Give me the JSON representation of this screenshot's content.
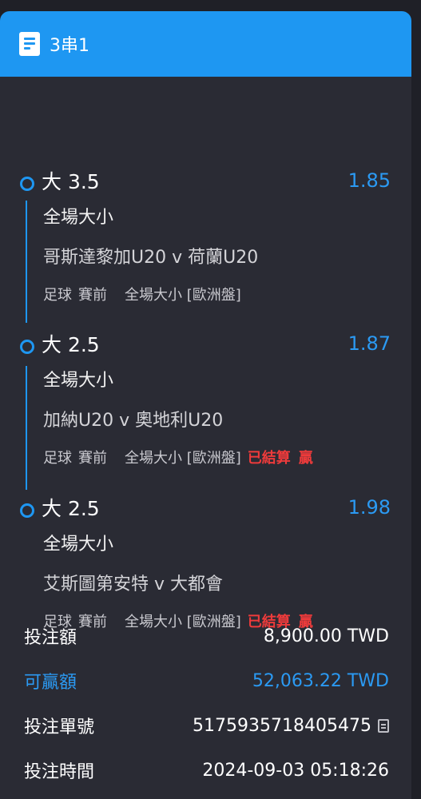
{
  "header": {
    "title": "3串1",
    "icon": "document-icon"
  },
  "legs": [
    {
      "pick": "大 3.5",
      "odds": "1.85",
      "market": "全場大小",
      "match": "哥斯達黎加U20 v 荷蘭U20",
      "sport": "足球",
      "stage": "賽前",
      "market_detail": "全場大小 [歐洲盤]",
      "status": "",
      "result": ""
    },
    {
      "pick": "大 2.5",
      "odds": "1.87",
      "market": "全場大小",
      "match": "加納U20 v 奧地利U20",
      "sport": "足球",
      "stage": "賽前",
      "market_detail": "全場大小 [歐洲盤]",
      "status": "已結算",
      "result": "贏"
    },
    {
      "pick": "大 2.5",
      "odds": "1.98",
      "market": "全場大小",
      "match": "艾斯圖第安特 v 大都會",
      "sport": "足球",
      "stage": "賽前",
      "market_detail": "全場大小 [歐洲盤]",
      "status": "已結算",
      "result": "贏"
    }
  ],
  "summary": {
    "stake_label": "投注額",
    "stake_value": "8,900.00 TWD",
    "payout_label": "可贏額",
    "payout_value": "52,063.22 TWD",
    "ticket_label": "投注單號",
    "ticket_value": "5175935718405475",
    "time_label": "投注時間",
    "time_value": "2024-09-03 05:18:26"
  },
  "colors": {
    "accent": "#1e97f2",
    "odds": "#2b9af3",
    "win": "#ee3b3b",
    "card": "#2a2b34",
    "background": "#1f2027"
  }
}
